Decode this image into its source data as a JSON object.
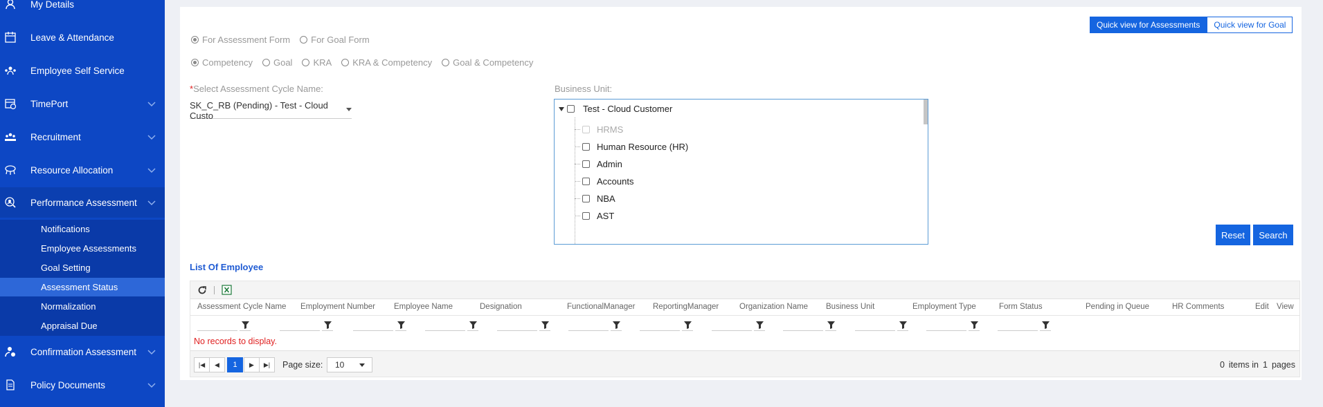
{
  "sidebar": {
    "items": [
      {
        "label": "My Details",
        "icon": "user-icon"
      },
      {
        "label": "Leave & Attendance",
        "icon": "calendar-icon"
      },
      {
        "label": "Employee Self Service",
        "icon": "people-network-icon"
      },
      {
        "label": "TimePort",
        "icon": "calendar-clock-icon"
      },
      {
        "label": "Recruitment",
        "icon": "group-icon"
      },
      {
        "label": "Resource Allocation",
        "icon": "sitemap-icon"
      },
      {
        "label": "Performance Assessment",
        "icon": "search-user-icon"
      },
      {
        "label": "Confirmation Assessment",
        "icon": "user-check-icon"
      },
      {
        "label": "Policy Documents",
        "icon": "document-icon"
      }
    ],
    "submenu": [
      "Notifications",
      "Employee Assessments",
      "Goal Setting",
      "Assessment Status",
      "Normalization",
      "Appraisal Due"
    ],
    "selected_submenu": "Assessment Status"
  },
  "quick_view": {
    "assessments": "Quick view for Assessments",
    "goal": "Quick view for Goal"
  },
  "form_type": {
    "options": [
      "For Assessment Form",
      "For Goal Form"
    ],
    "selected": "For Assessment Form"
  },
  "assessment_type": {
    "options": [
      "Competency",
      "Goal",
      "KRA",
      "KRA & Competency",
      "Goal & Competency"
    ],
    "selected": "Competency"
  },
  "cycle": {
    "required_mark": "*",
    "label": "Select Assessment Cycle Name:",
    "value": "SK_C_RB (Pending) - Test - Cloud Custo"
  },
  "business_unit": {
    "label": "Business Unit:",
    "root": "Test - Cloud Customer",
    "children": [
      {
        "label": "HRMS",
        "disabled": true
      },
      {
        "label": "Human Resource (HR)",
        "disabled": false
      },
      {
        "label": "Admin",
        "disabled": false
      },
      {
        "label": "Accounts",
        "disabled": false
      },
      {
        "label": "NBA",
        "disabled": false
      },
      {
        "label": "AST",
        "disabled": false
      }
    ]
  },
  "buttons": {
    "reset": "Reset",
    "search": "Search"
  },
  "list_title": "List Of Employee",
  "grid": {
    "columns": [
      "Assessment Cycle Name",
      "Employment Number",
      "Employee Name",
      "Designation",
      "FunctionalManager",
      "ReportingManager",
      "Organization Name",
      "Business Unit",
      "Employment Type",
      "Form Status",
      "Pending in Queue",
      "HR Comments",
      "Edit",
      "View"
    ],
    "no_records": "No records to display.",
    "pager": {
      "current_page": "1",
      "page_size_label": "Page size:",
      "page_size": "10",
      "item_count": "0",
      "items_in": "items in",
      "page_count": "1",
      "pages": "pages"
    }
  },
  "colors": {
    "sidebar": "#0d47c4",
    "accent": "#1565e0",
    "error": "#e02020"
  }
}
